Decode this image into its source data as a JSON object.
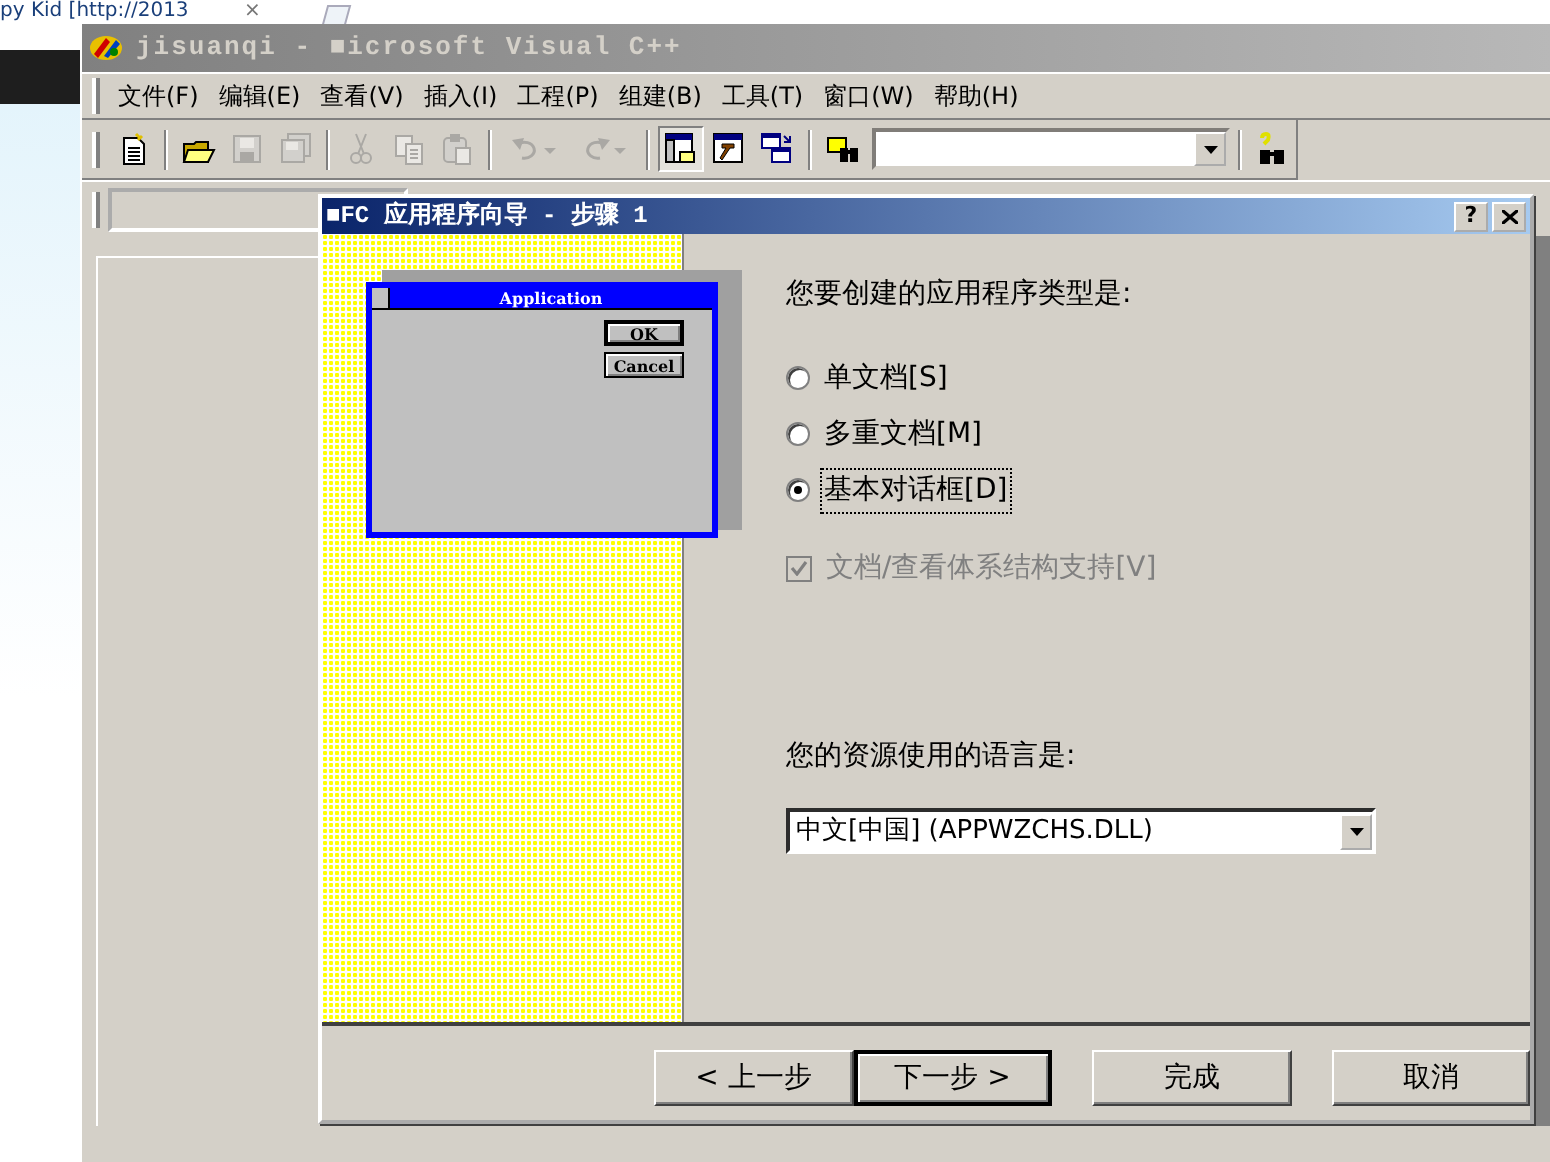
{
  "browser_tab": {
    "title": "py Kid [http://2013",
    "close": "×"
  },
  "ide": {
    "title": "jisuanqi - ■icrosoft Visual C++",
    "menu": [
      "文件(F)",
      "编辑(E)",
      "查看(V)",
      "插入(I)",
      "工程(P)",
      "组建(B)",
      "工具(T)",
      "窗口(W)",
      "帮助(H)"
    ],
    "toolbar": [
      {
        "kind": "new",
        "disabled": false
      },
      {
        "kind": "separator"
      },
      {
        "kind": "open",
        "disabled": false
      },
      {
        "kind": "save",
        "disabled": true
      },
      {
        "kind": "save-all",
        "disabled": true
      },
      {
        "kind": "separator"
      },
      {
        "kind": "cut",
        "disabled": true
      },
      {
        "kind": "copy",
        "disabled": true
      },
      {
        "kind": "paste",
        "disabled": true
      },
      {
        "kind": "separator"
      },
      {
        "kind": "undo",
        "disabled": true
      },
      {
        "kind": "redo",
        "disabled": true
      },
      {
        "kind": "separator"
      },
      {
        "kind": "workspace",
        "disabled": false,
        "selected": true
      },
      {
        "kind": "output",
        "disabled": false,
        "selected": false
      },
      {
        "kind": "windows",
        "disabled": false,
        "selected": false
      },
      {
        "kind": "separator"
      },
      {
        "kind": "find-in-files",
        "disabled": false
      },
      {
        "kind": "combo"
      },
      {
        "kind": "separator"
      },
      {
        "kind": "search",
        "disabled": false
      }
    ]
  },
  "dialog": {
    "title": "■FC 应用程序向导 - 步骤 1",
    "help": "?",
    "preview": {
      "title": "Application",
      "buttons": [
        {
          "label": "OK",
          "default": true
        },
        {
          "label": "Cancel",
          "default": false
        }
      ]
    },
    "question": "您要创建的应用程序类型是:",
    "options": [
      {
        "label": "单文档[S]",
        "selected": false
      },
      {
        "label": "多重文档[M]",
        "selected": false
      },
      {
        "label": "基本对话框[D]",
        "selected": true
      }
    ],
    "doc_view": {
      "label": "文档/查看体系结构支持[V]",
      "checked": true,
      "disabled": true
    },
    "language_label": "您的资源使用的语言是:",
    "language": {
      "value": "中文[中国] (APPWZCHS.DLL)"
    },
    "buttons": [
      {
        "label": "< 上一步",
        "default": false
      },
      {
        "label": "下一步 >",
        "default": true
      },
      {
        "label": "完成",
        "default": false
      },
      {
        "label": "取消",
        "default": false
      }
    ]
  }
}
